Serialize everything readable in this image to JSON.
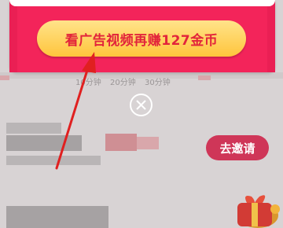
{
  "popup": {
    "watch_ad_button": "看广告视频再赚127金币"
  },
  "timeline": {
    "labels": [
      "10分钟",
      "20分钟",
      "30分钟"
    ]
  },
  "invite_button": "去邀请",
  "colors": {
    "popup_red": "#f3245a",
    "button_yellow": "#ffd35c",
    "button_text": "#e2243b",
    "invite_red": "#cf3658",
    "annotation_arrow": "#e02020"
  },
  "icons": {
    "close": "close-icon",
    "gift": "gift-icon",
    "arrow": "annotation-arrow"
  }
}
